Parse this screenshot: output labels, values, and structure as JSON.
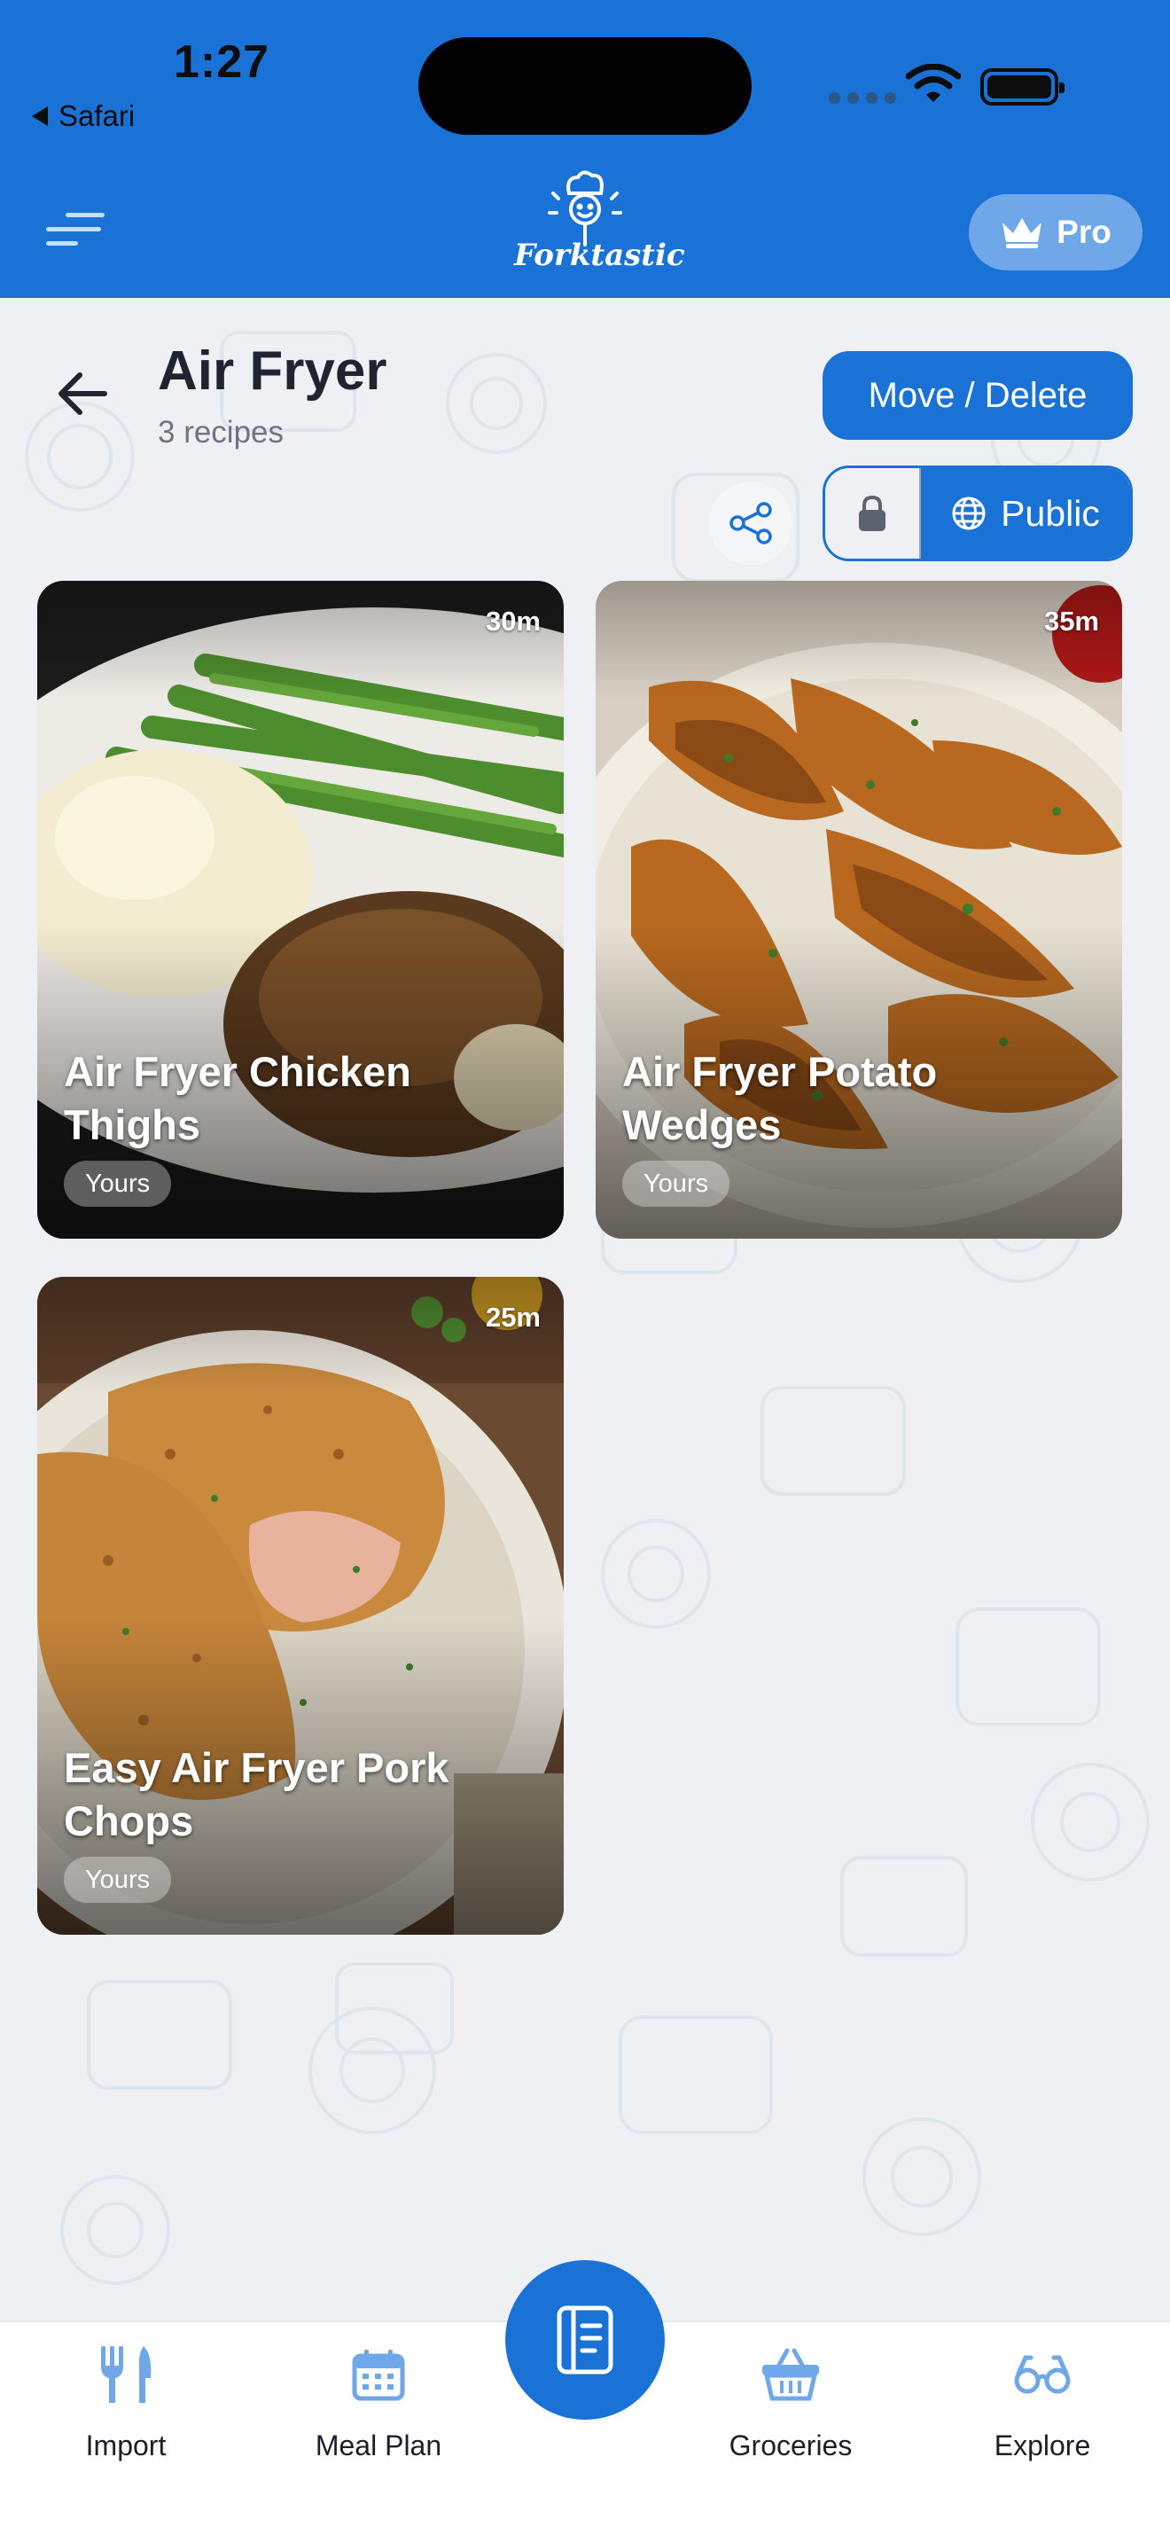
{
  "status_bar": {
    "time": "1:27",
    "back_app": "Safari"
  },
  "header": {
    "logo_text": "Forktastic",
    "pro_label": "Pro"
  },
  "collection": {
    "title": "Air Fryer",
    "count_label": "3 recipes",
    "move_delete_label": "Move / Delete",
    "visibility": {
      "public_label": "Public",
      "selected": "Public"
    }
  },
  "recipes": [
    {
      "title": "Air Fryer Chicken Thighs",
      "time": "30m",
      "owner": "Yours"
    },
    {
      "title": "Air Fryer Potato Wedges",
      "time": "35m",
      "owner": "Yours"
    },
    {
      "title": "Easy Air Fryer Pork Chops",
      "time": "25m",
      "owner": "Yours"
    }
  ],
  "bottom_nav": {
    "items": [
      {
        "label": "Import",
        "icon": "utensils-icon"
      },
      {
        "label": "Meal Plan",
        "icon": "calendar-icon"
      },
      {
        "label": "Groceries",
        "icon": "basket-icon"
      },
      {
        "label": "Explore",
        "icon": "glasses-icon"
      }
    ],
    "center_icon": "recipe-book-icon"
  },
  "colors": {
    "brand": "#1a72d6",
    "background": "#eef0f3",
    "nav_icon": "#6fa7e8"
  }
}
